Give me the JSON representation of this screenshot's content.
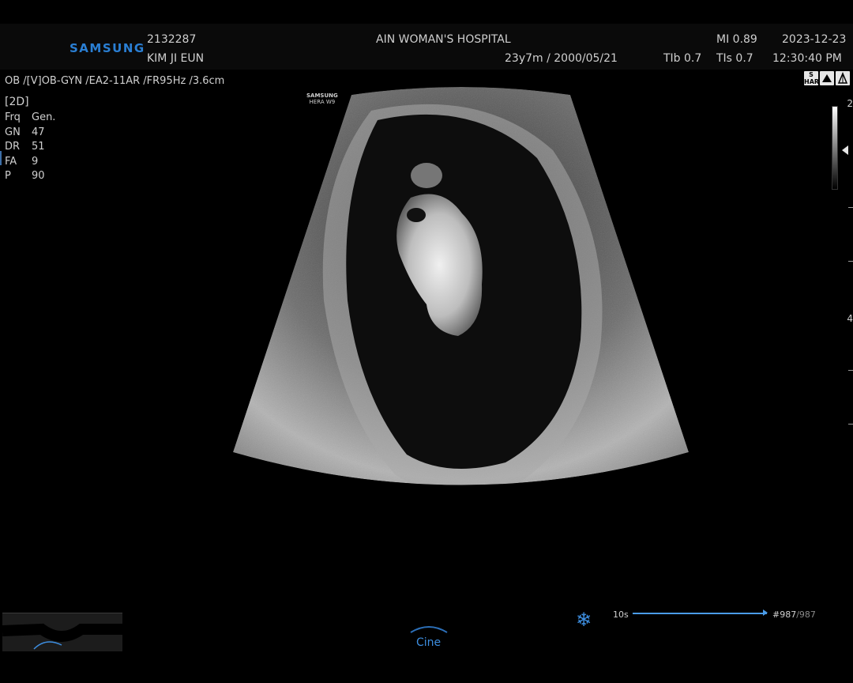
{
  "header": {
    "brand": "SAMSUNG",
    "patient_id": "2132287",
    "patient_name": "KIM JI EUN",
    "hospital": "AIN WOMAN'S HOSPITAL",
    "age_dob": "23y7m / 2000/05/21",
    "mi": "MI  0.89",
    "tib": "TIb 0.7",
    "tis": "TIs 0.7",
    "date": "2023-12-23",
    "time": "12:30:40 PM"
  },
  "exam_line": "OB /[V]OB-GYN /EA2-11AR /FR95Hz /3.6cm",
  "mode": "[2D]",
  "params": [
    {
      "key": "Frq",
      "value": "Gen."
    },
    {
      "key": "GN",
      "value": "47"
    },
    {
      "key": "DR",
      "value": "51"
    },
    {
      "key": "FA",
      "value": "9"
    },
    {
      "key": "P",
      "value": "90"
    }
  ],
  "device_watermark": {
    "line1": "SAMSUNG",
    "line2": "HERA W9"
  },
  "depth_scale": {
    "top": "2",
    "mid": "4"
  },
  "status_icons": [
    "S HAR",
    "probe-icon",
    "body-icon"
  ],
  "cine": {
    "label": "Cine",
    "duration": "10s",
    "frame_current": "#987",
    "frame_total": "/987",
    "progress": 1.0
  },
  "colors": {
    "brand": "#2a7fd4",
    "cine_accent": "#3d8ee0",
    "freeze_icon": "#3d8ee0"
  }
}
